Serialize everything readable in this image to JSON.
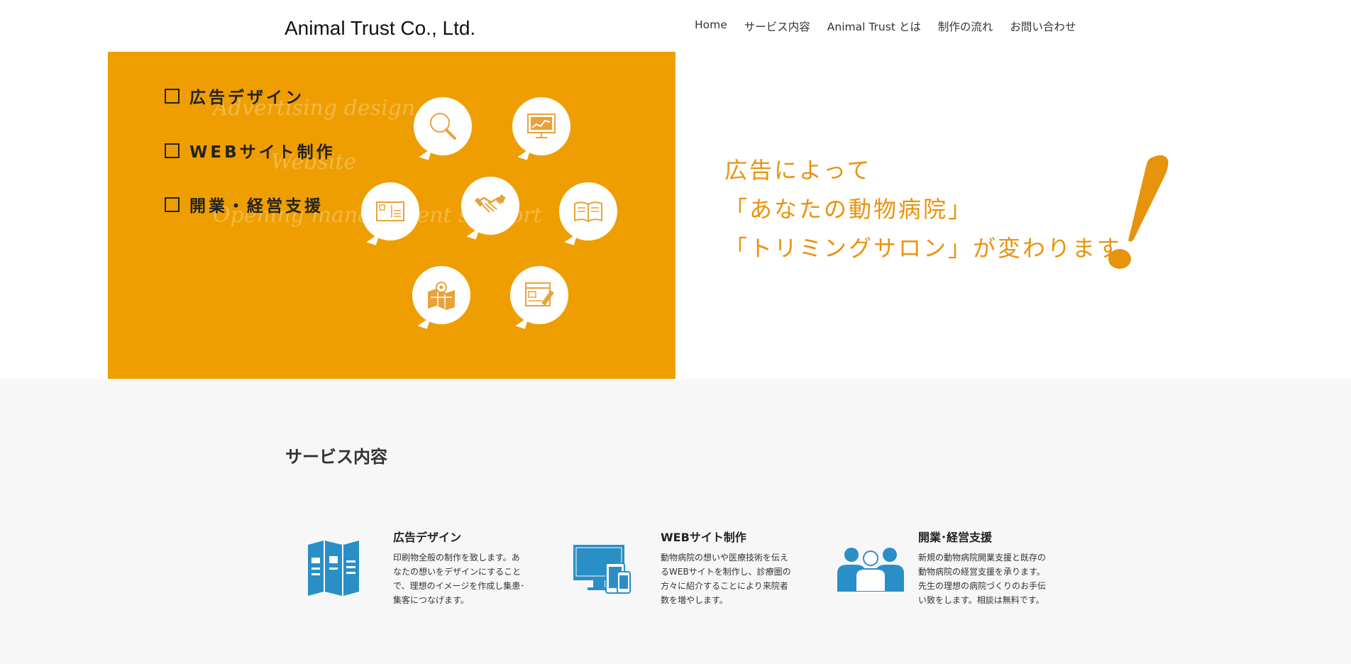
{
  "header": {
    "brand": "Animal Trust Co., Ltd.",
    "nav": [
      "Home",
      "サービス内容",
      "Animal Trust とは",
      "制作の流れ",
      "お問い合わせ"
    ]
  },
  "hero": {
    "menu": [
      "広告デザイン",
      "WEBサイト制作",
      "開業・経営支援"
    ],
    "scripts": [
      "Advertising design",
      "Website",
      "Opening management support"
    ],
    "tagline": [
      "広告によって",
      "「あなたの動物病院」",
      "「トリミングサロン」が変わります"
    ],
    "colors": {
      "orange": "#ee9e00",
      "tagline": "#e8930d"
    },
    "icons": [
      "magnifier-icon",
      "monitor-chart-icon",
      "postcard-icon",
      "handshake-icon",
      "book-icon",
      "map-pin-icon",
      "browser-edit-icon"
    ]
  },
  "services": {
    "title": "サービス内容",
    "items": [
      {
        "title": "広告デザイン",
        "icon": "brochure-icon",
        "text": "印刷物全般の制作を致します。あなたの想いをデザインにすることで、理想のイメージを作成し集患･集客につなげます。"
      },
      {
        "title": "WEBサイト制作",
        "icon": "devices-icon",
        "text": "動物病院の想いや医療技術を伝えるWEBサイトを制作し、診療圏の方々に紹介することにより来院者数を増やします。"
      },
      {
        "title": "開業･経営支援",
        "icon": "people-icon",
        "text": "新規の動物病院開業支援と既存の動物病院の経営支援を承ります。先生の理想の病院づくりのお手伝い致をします。相談は無料です。"
      }
    ],
    "icon_color": "#2a8fc6"
  }
}
